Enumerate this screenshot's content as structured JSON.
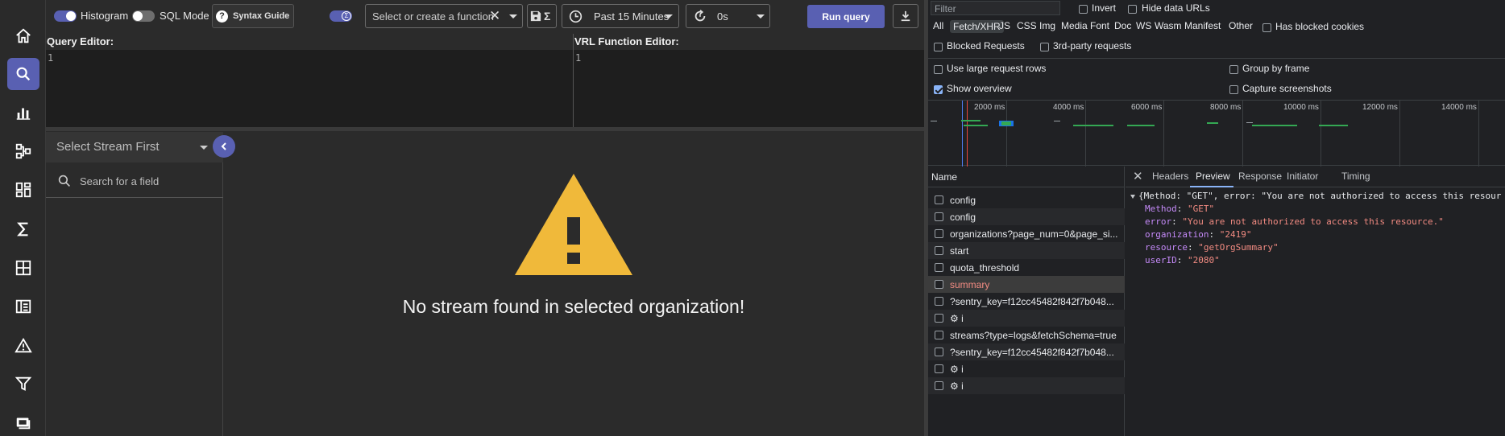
{
  "toolbar": {
    "histogram_label": "Histogram",
    "sql_mode_label": "SQL Mode",
    "syntax_guide_label": "Syntax Guide",
    "function_placeholder": "Select or create a function",
    "time_range": "Past 15 Minutes",
    "refresh_interval": "0s",
    "run_query_label": "Run query",
    "histogram_on": true,
    "sql_mode_on": false
  },
  "editors": {
    "query_title": "Query Editor:",
    "query_line": "1",
    "vrl_title": "VRL Function Editor:",
    "vrl_line": "1"
  },
  "field_panel": {
    "stream_placeholder": "Select Stream First",
    "search_placeholder": "Search for a field"
  },
  "empty_state": {
    "message": "No stream found in selected organization!"
  },
  "colors": {
    "accent": "#5960b2",
    "warning": "#f0b93a"
  },
  "devtools": {
    "filter_placeholder": "Filter",
    "invert_label": "Invert",
    "hide_data_urls_label": "Hide data URLs",
    "filter_types": [
      "All",
      "Fetch/XHR",
      "JS",
      "CSS",
      "Img",
      "Media",
      "Font",
      "Doc",
      "WS",
      "Wasm",
      "Manifest",
      "Other"
    ],
    "active_filter": "Fetch/XHR",
    "has_blocked_cookies_label": "Has blocked cookies",
    "blocked_requests_label": "Blocked Requests",
    "third_party_label": "3rd-party requests",
    "large_rows_label": "Use large request rows",
    "group_by_frame_label": "Group by frame",
    "show_overview_label": "Show overview",
    "show_overview_checked": true,
    "capture_screenshots_label": "Capture screenshots",
    "timeline_ticks": [
      "2000 ms",
      "4000 ms",
      "6000 ms",
      "8000 ms",
      "10000 ms",
      "12000 ms",
      "14000 ms"
    ],
    "name_header": "Name",
    "requests": [
      {
        "name": "config",
        "error": false
      },
      {
        "name": "config",
        "error": false
      },
      {
        "name": "organizations?page_num=0&page_si...",
        "error": false
      },
      {
        "name": "start",
        "error": false
      },
      {
        "name": "quota_threshold",
        "error": false
      },
      {
        "name": "summary",
        "error": true
      },
      {
        "name": "?sentry_key=f12cc45482f842f7b048...",
        "error": false
      },
      {
        "name": "⚙ i",
        "error": false
      },
      {
        "name": "streams?type=logs&fetchSchema=true",
        "error": false
      },
      {
        "name": "?sentry_key=f12cc45482f842f7b048...",
        "error": false
      },
      {
        "name": "⚙ i",
        "error": false
      },
      {
        "name": "⚙ i",
        "error": false
      }
    ],
    "detail_tabs": [
      "Headers",
      "Preview",
      "Response",
      "Initiator",
      "Timing"
    ],
    "active_detail_tab": "Preview",
    "preview": {
      "summary": "{Method: \"GET\", error: \"You are not authorized to access this resour",
      "fields": [
        {
          "key": "Method",
          "value": "\"GET\""
        },
        {
          "key": "error",
          "value": "\"You are not authorized to access this resource.\""
        },
        {
          "key": "organization",
          "value": "\"2419\""
        },
        {
          "key": "resource",
          "value": "\"getOrgSummary\""
        },
        {
          "key": "userID",
          "value": "\"2080\""
        }
      ]
    }
  }
}
